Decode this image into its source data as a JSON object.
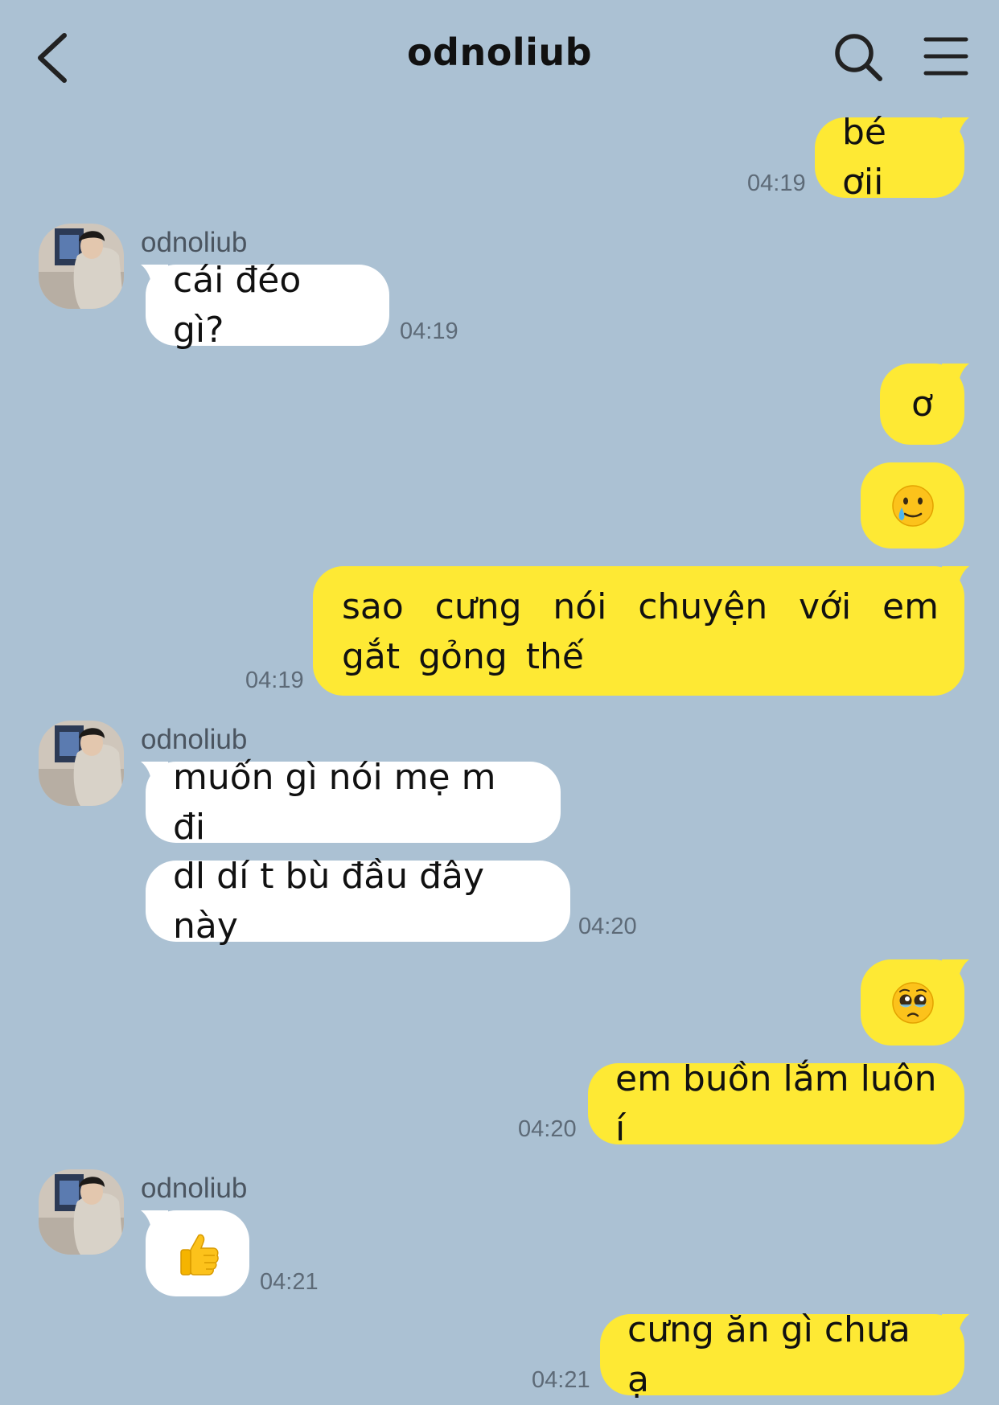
{
  "header": {
    "title": "odnoliub",
    "back_icon": "chevron-left-icon",
    "search_icon": "search-icon",
    "menu_icon": "menu-icon"
  },
  "colors": {
    "background": "#abc1d3",
    "my_bubble": "#fee934",
    "their_bubble": "#ffffff",
    "timestamp": "#5d6a77"
  },
  "messages": [
    {
      "from": "me",
      "text": "bé ơii",
      "time": "04:19"
    },
    {
      "from": "them",
      "sender": "odnoliub",
      "text": "cái đéo gì?",
      "time": "04:19"
    },
    {
      "from": "me",
      "text": "ơ"
    },
    {
      "from": "me",
      "emoji": "crying-smile-emoji"
    },
    {
      "from": "me",
      "text": "sao cưng nói chuyện với em gắt gỏng thế",
      "time": "04:19"
    },
    {
      "from": "them",
      "sender": "odnoliub",
      "text": "muốn gì nói mẹ m đi"
    },
    {
      "from": "them",
      "text": "dl dí t bù đầu đây này",
      "time": "04:20"
    },
    {
      "from": "me",
      "emoji": "pleading-face-emoji"
    },
    {
      "from": "me",
      "text": "em buồn lắm luôn í",
      "time": "04:20"
    },
    {
      "from": "them",
      "sender": "odnoliub",
      "emoji": "thumbs-up-emoji",
      "time": "04:21"
    },
    {
      "from": "me",
      "text": "cưng ăn gì chưa ạ",
      "time": "04:21"
    }
  ]
}
